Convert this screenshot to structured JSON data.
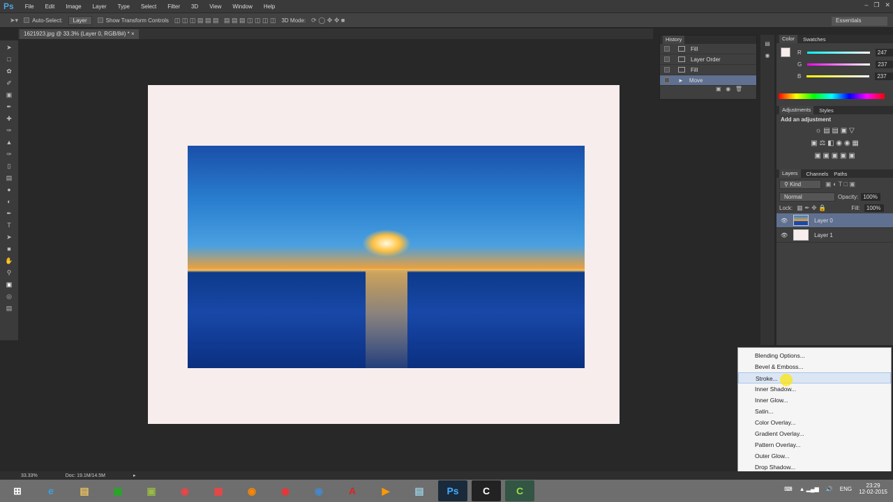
{
  "menu": {
    "logo": "Ps",
    "items": [
      "File",
      "Edit",
      "Image",
      "Layer",
      "Type",
      "Select",
      "Filter",
      "3D",
      "View",
      "Window",
      "Help"
    ]
  },
  "options": {
    "auto_select": "Auto-Select:",
    "auto_select_value": "Layer",
    "show_transform": "Show Transform Controls",
    "mode_3d": "3D Mode:",
    "workspace": "Essentials"
  },
  "document": {
    "tab": "1621923.jpg @ 33.3% (Layer 0, RGB/8#) *"
  },
  "history": {
    "title": "History",
    "items": [
      "Fill",
      "Layer Order",
      "Fill",
      "Move"
    ],
    "active": 3
  },
  "color": {
    "tabs": [
      "Color",
      "Swatches"
    ],
    "r": "247",
    "g": "237",
    "b": "237",
    "r_label": "R",
    "g_label": "G",
    "b_label": "B"
  },
  "adjustments": {
    "tabs": [
      "Adjustments",
      "Styles"
    ],
    "heading": "Add an adjustment"
  },
  "layers": {
    "tabs": [
      "Layers",
      "Channels",
      "Paths"
    ],
    "kind": "Kind",
    "blend": "Normal",
    "opacity_label": "Opacity:",
    "opacity": "100%",
    "lock_label": "Lock:",
    "fill_label": "Fill:",
    "fill": "100%",
    "items": [
      "Layer 0",
      "Layer 1"
    ]
  },
  "context_menu": {
    "items": [
      "Blending Options...",
      "Bevel & Emboss...",
      "Stroke...",
      "Inner Shadow...",
      "Inner Glow...",
      "Satin...",
      "Color Overlay...",
      "Gradient Overlay...",
      "Pattern Overlay...",
      "Outer Glow...",
      "Drop Shadow..."
    ],
    "highlighted": 2
  },
  "status": {
    "zoom": "33.33%",
    "doc": "Doc: 19.1M/14.5M"
  },
  "taskbar": {
    "lang": "ENG",
    "time": "23:29",
    "date": "12-02-2015",
    "ps": "Ps"
  }
}
